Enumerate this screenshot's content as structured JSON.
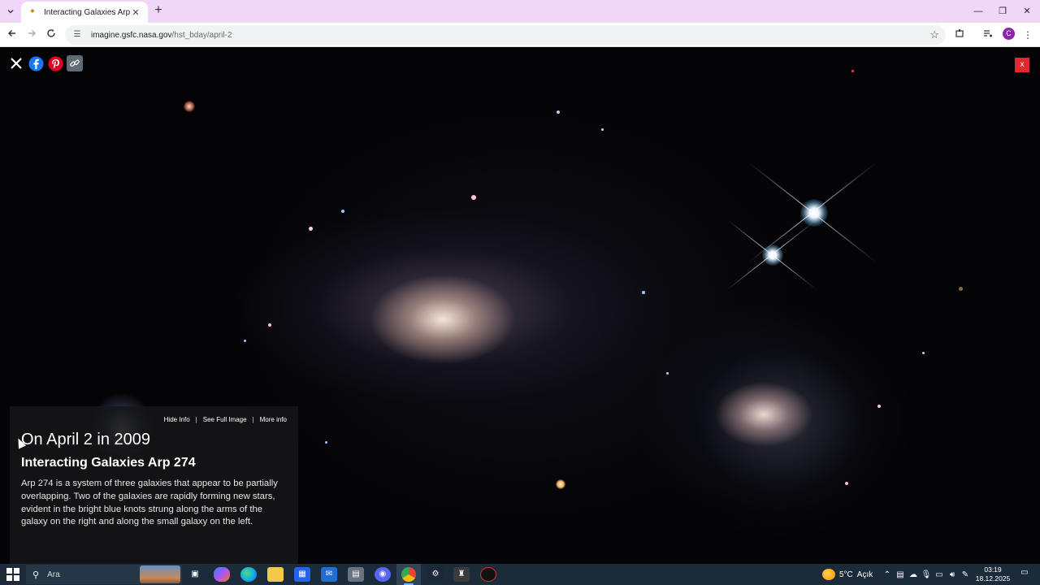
{
  "browser": {
    "tab_title": "Interacting Galaxies Arp 274",
    "tab_close": "✕",
    "new_tab": "+",
    "url_host": "imagine.gsfc.nasa.gov",
    "url_path": "/hst_bday/april-2",
    "profile_initial": "C"
  },
  "page": {
    "close_label": "x",
    "info": {
      "hide_info": "Hide Info",
      "see_full_image": "See Full Image",
      "more_info": "More info",
      "separator": "|",
      "date_line": "On April 2 in 2009",
      "title": "Interacting Galaxies Arp 274",
      "description": "Arp 274 is a system of three galaxies that appear to be partially overlapping. Two of the galaxies are rapidly forming new stars, evident in the bright blue knots strung along the arms of the galaxy on the right and along the small galaxy on the left."
    }
  },
  "taskbar": {
    "search_placeholder": "Ara",
    "weather_temp": "5°C",
    "weather_desc": "Açık",
    "time": "03:19",
    "date": "18.12.2025"
  }
}
